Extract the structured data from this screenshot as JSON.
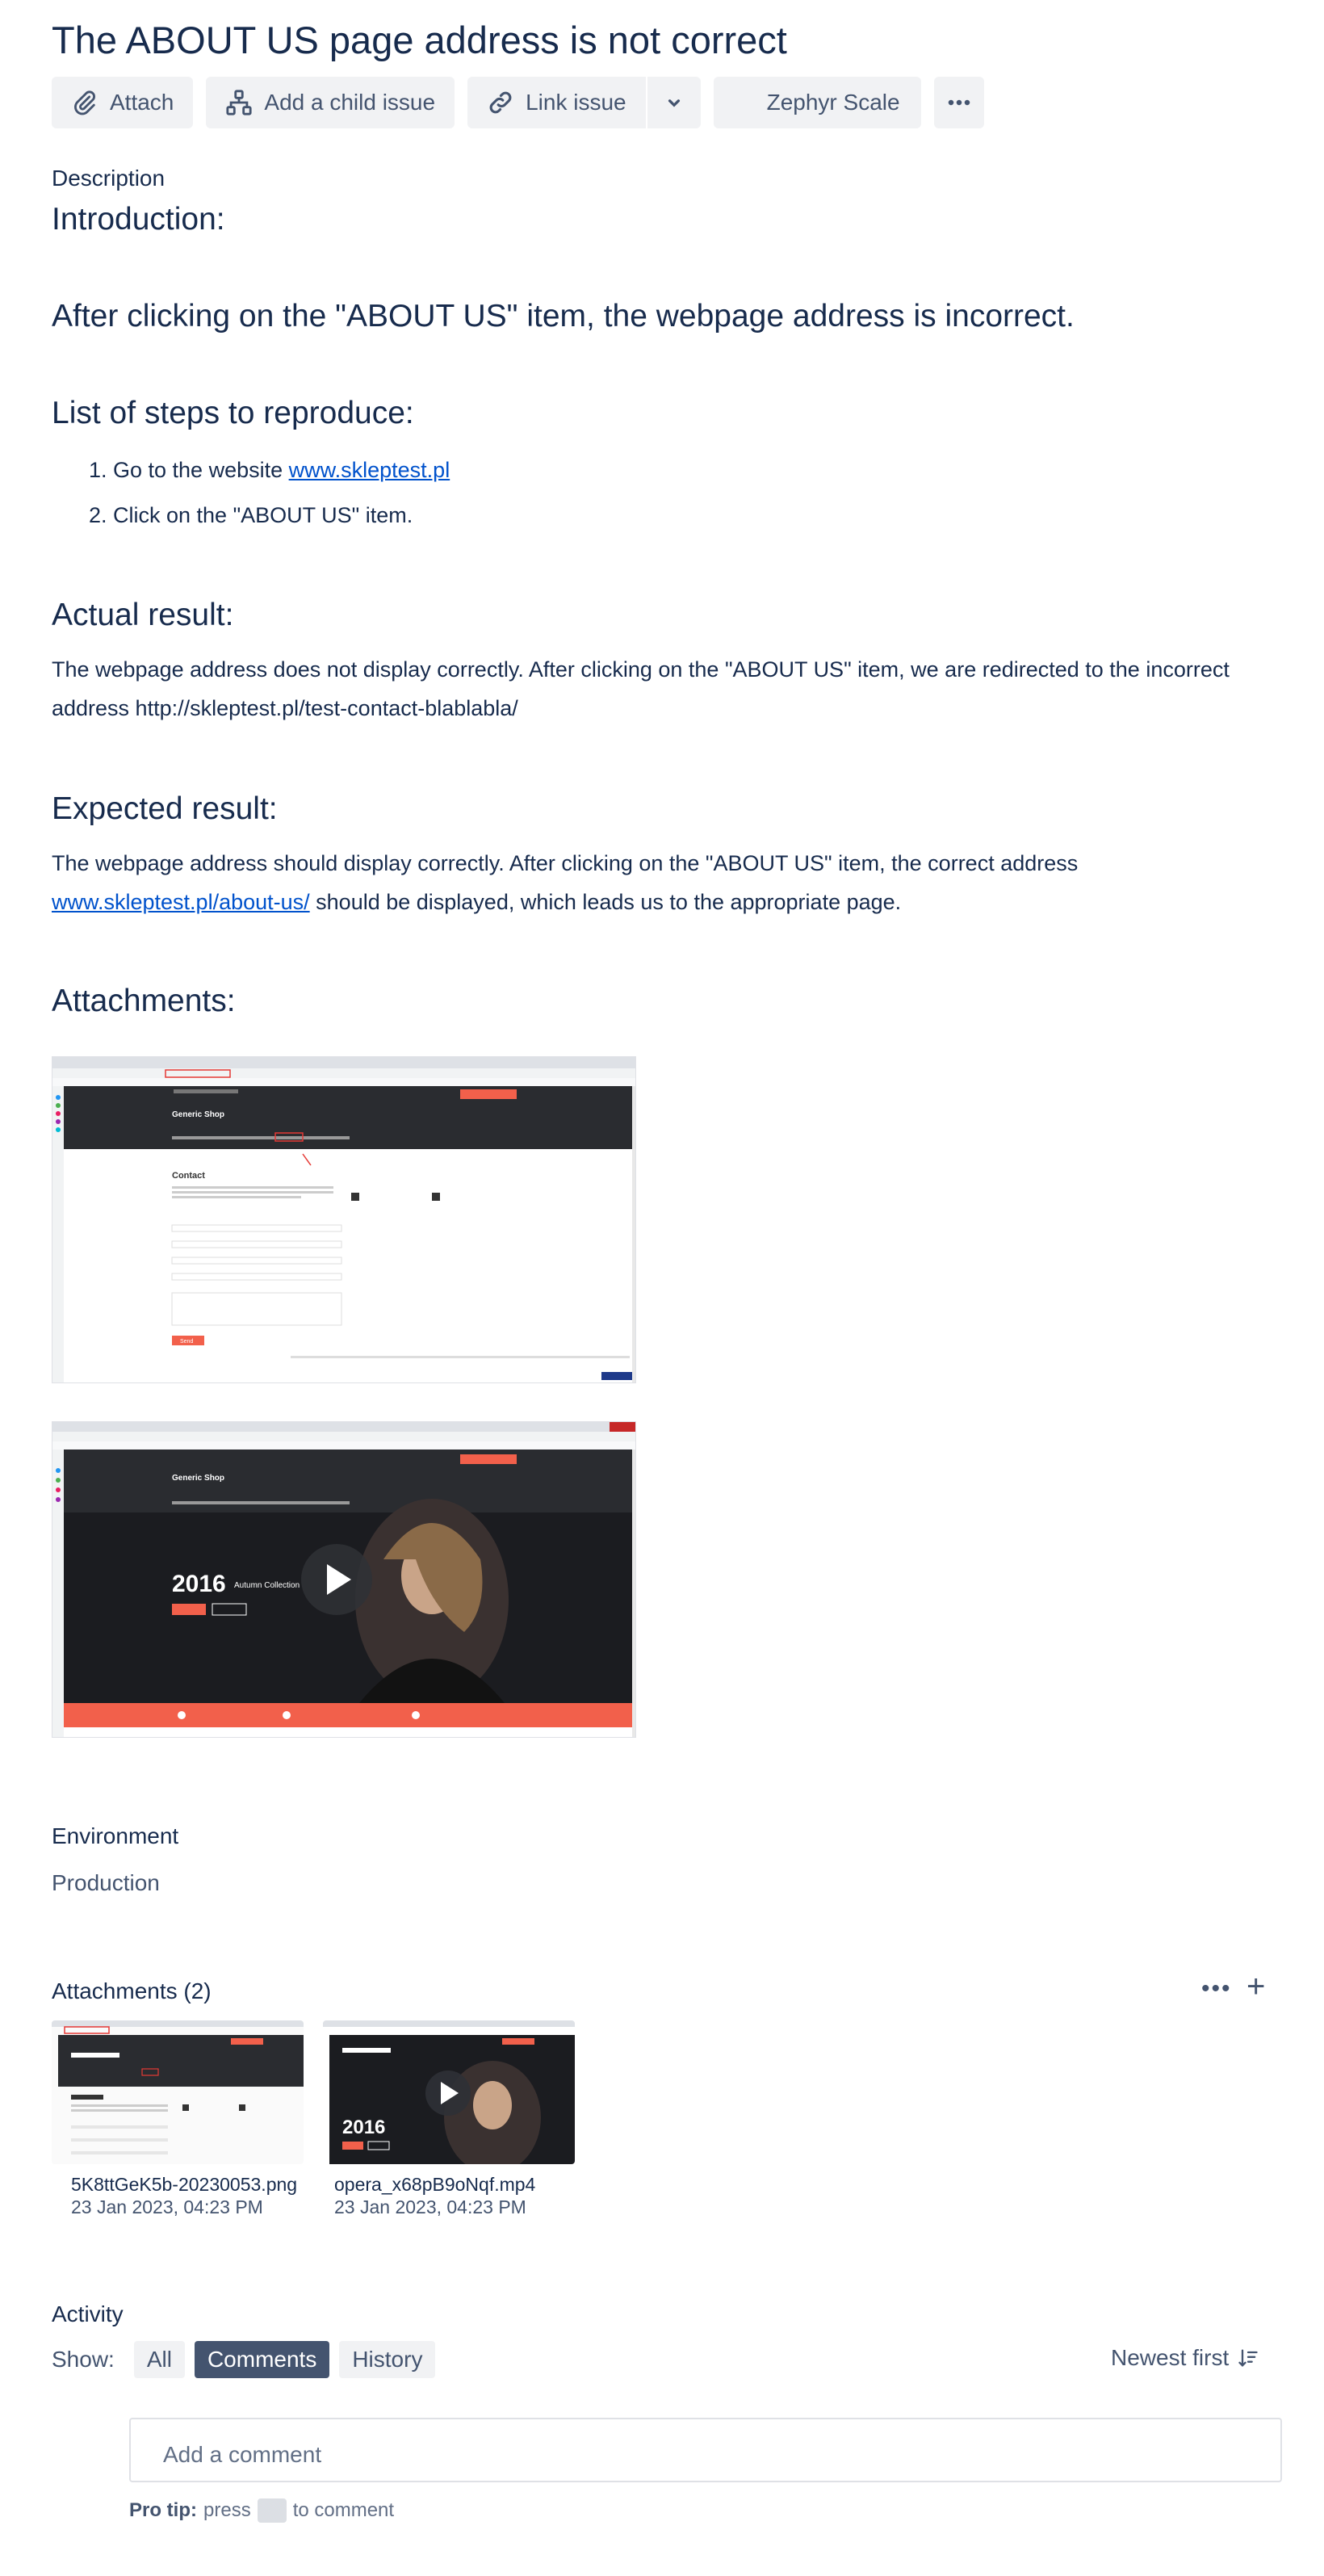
{
  "issue": {
    "title": "The ABOUT US page address is not correct"
  },
  "toolbar": {
    "attach": "Attach",
    "child_issue": "Add a child issue",
    "link_issue": "Link issue",
    "zephyr": "Zephyr Scale"
  },
  "description": {
    "label": "Description",
    "intro_heading": "Introduction:",
    "summary": "After clicking on the \"ABOUT US\" item, the webpage address is incorrect.",
    "steps_heading": "List of steps to reproduce:",
    "steps": {
      "s1_num": "1.",
      "s1_text": "Go to the website ",
      "s1_link": "www.skleptest.pl",
      "s2_num": "2.",
      "s2_text": "Click on the \"ABOUT US\" item."
    },
    "actual_heading": "Actual result:",
    "actual_text": "The webpage address does not display correctly. After clicking on the \"ABOUT US\" item, we are redirected to the incorrect address http://skleptest.pl/test-contact-blablabla/",
    "expected_heading": "Expected result:",
    "expected_text_1": "The webpage address should display correctly. After clicking on the \"ABOUT US\" item, the correct address ",
    "expected_link": "www.skleptest.pl/about-us/",
    "expected_text_2": " should be displayed, which leads us to the appropriate page.",
    "attachments_heading": "Attachments:"
  },
  "screenshot_content": {
    "shop_name": "Generic Shop",
    "contact_title": "Contact",
    "nav": [
      "SHOP",
      "MOST WANTED",
      "CATEGORIES",
      "ABOUT US",
      "CONTACT",
      "BLOG"
    ],
    "hero_year": "2016",
    "hero_caption": "Autumn Collection",
    "shop_now": "Shop Now",
    "learn_more": "Learn More",
    "send": "Send"
  },
  "environment": {
    "label": "Environment",
    "value": "Production"
  },
  "attachments": {
    "label": "Attachments (2)",
    "more": "•••",
    "add": "+",
    "files": [
      {
        "name": "5K8ttGeK5b-20230053.png",
        "date": "23 Jan 2023, 04:23 PM"
      },
      {
        "name": "opera_x68pB9oNqf.mp4",
        "date": "23 Jan 2023, 04:23 PM"
      }
    ]
  },
  "activity": {
    "label": "Activity",
    "show_label": "Show:",
    "filters": [
      "All",
      "Comments",
      "History"
    ],
    "active_filter": "Comments",
    "sort": "Newest first",
    "comment_placeholder": "Add a comment",
    "protip_bold": "Pro tip:",
    "protip_press": "press",
    "protip_end": "to comment"
  },
  "colors": {
    "text": "#172b4d",
    "link": "#0052cc",
    "accent": "#f2604b",
    "active_pill": "#44546f"
  }
}
